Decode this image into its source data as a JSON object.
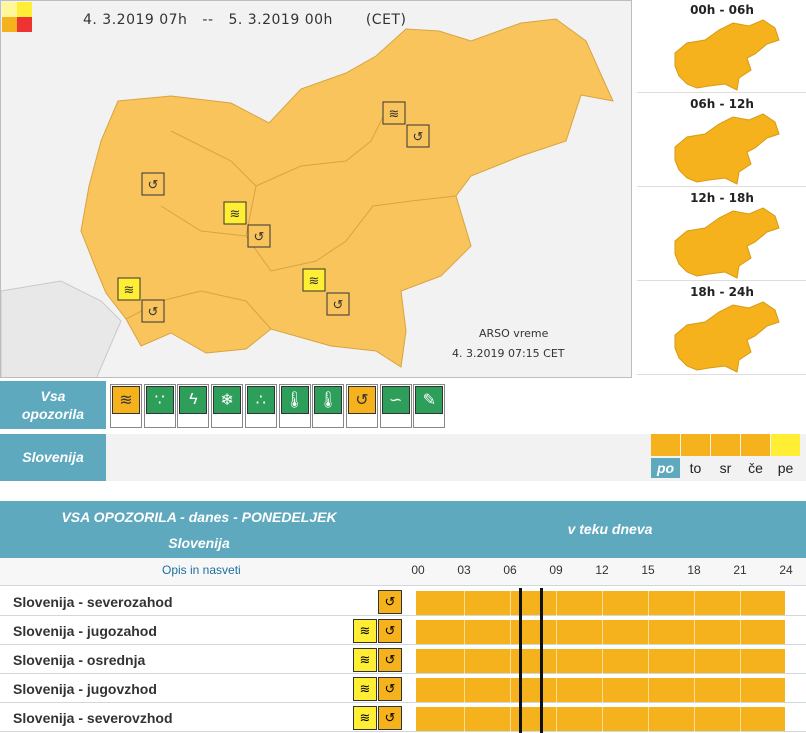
{
  "colors": {
    "orange": "#f5b21d",
    "yellow": "#ffee33",
    "teal": "#5fa9bf",
    "map_land": "#f9c45c"
  },
  "map": {
    "title_from": "4. 3.2019  07h",
    "title_sep": "--",
    "title_to": "5. 3.2019  00h",
    "title_tz": "(CET)",
    "credit_name": "ARSO vreme",
    "credit_time": "4. 3.2019   07:15 CET"
  },
  "time_slots": [
    {
      "label": "00h - 06h"
    },
    {
      "label": "06h - 12h"
    },
    {
      "label": "12h - 18h"
    },
    {
      "label": "18h - 24h"
    }
  ],
  "filter": {
    "all_label_1": "Vsa",
    "all_label_2": "opozorila",
    "icons": [
      "wind-icon",
      "rain-icon",
      "thunderstorm-icon",
      "snow-icon",
      "snow-rain-icon",
      "high-temperature-icon",
      "low-temperature-icon",
      "coastal-event-icon",
      "fog-icon",
      "forest-fire-icon"
    ]
  },
  "region_label": "Slovenija",
  "days": [
    {
      "label": "po",
      "color": "#f5b21d",
      "selected": true
    },
    {
      "label": "to",
      "color": "#f5b21d"
    },
    {
      "label": "sr",
      "color": "#f5b21d"
    },
    {
      "label": "če",
      "color": "#f5b21d"
    },
    {
      "label": "pe",
      "color": "#ffee33"
    }
  ],
  "table": {
    "title": "VSA OPOZORILA - danes - PONEDELJEK",
    "subtitle": "Slovenija",
    "right_title": "v teku dneva",
    "col_label": "Opis in nasveti",
    "hours": [
      "00",
      "03",
      "06",
      "09",
      "12",
      "15",
      "18",
      "21",
      "24"
    ],
    "rows": [
      {
        "name": "Slovenija - severozahod",
        "icons": [
          "coastal-event-icon"
        ]
      },
      {
        "name": "Slovenija - jugozahod",
        "icons": [
          "wind-icon",
          "coastal-event-icon"
        ]
      },
      {
        "name": "Slovenija - osrednja",
        "icons": [
          "wind-icon",
          "coastal-event-icon"
        ]
      },
      {
        "name": "Slovenija - jugovzhod",
        "icons": [
          "wind-icon",
          "coastal-event-icon"
        ]
      },
      {
        "name": "Slovenija - severovzhod",
        "icons": [
          "wind-icon",
          "coastal-event-icon"
        ]
      }
    ]
  }
}
